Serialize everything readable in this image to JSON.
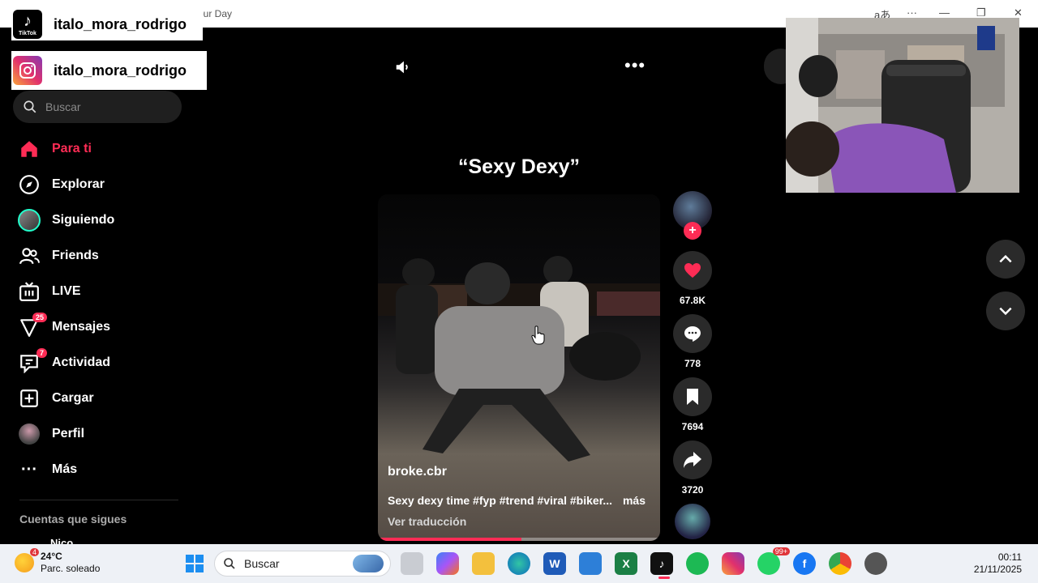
{
  "window": {
    "title_fragment": "our Day",
    "lang_glyph": "aあ",
    "more": "···",
    "minimize": "—",
    "restore": "❐",
    "close": "✕"
  },
  "overlays": {
    "tiktok_badge": {
      "username": "italo_mora_rodrigo",
      "logo_caption": "TikTok"
    },
    "instagram_badge": {
      "username": "italo_mora_rodrigo"
    }
  },
  "sidebar": {
    "search_placeholder": "Buscar",
    "items": [
      {
        "label": "Para ti",
        "icon": "home-icon",
        "active": true
      },
      {
        "label": "Explorar",
        "icon": "compass-icon"
      },
      {
        "label": "Siguiendo",
        "icon": "avatar"
      },
      {
        "label": "Friends",
        "icon": "friends-icon"
      },
      {
        "label": "LIVE",
        "icon": "live-icon"
      },
      {
        "label": "Mensajes",
        "icon": "messages-icon",
        "badge": "25"
      },
      {
        "label": "Actividad",
        "icon": "activity-icon",
        "badge": "7"
      },
      {
        "label": "Cargar",
        "icon": "upload-icon"
      },
      {
        "label": "Perfil",
        "icon": "profile-avatar"
      },
      {
        "label": "Más",
        "icon": "more-icon"
      }
    ],
    "following_title": "Cuentas que sigues",
    "following_first": "Nico"
  },
  "video": {
    "caption": "“Sexy Dexy”",
    "author": "broke.cbr",
    "description": "Sexy dexy time #fyp #trend #viral #biker...",
    "more_label": "más",
    "translate_label": "Ver traducción",
    "progress": 0.51
  },
  "actions": {
    "likes": "67.8K",
    "comments": "778",
    "saves": "7694",
    "shares": "3720"
  },
  "taskbar": {
    "weather_temp": "24°C",
    "weather_cond": "Parc. soleado",
    "weather_badge": "4",
    "search_label": "Buscar",
    "whatsapp_badge": "99+",
    "time": "00:11",
    "date": "21/11/2025"
  },
  "colors": {
    "accent": "#fe2c55",
    "background": "#000000",
    "taskbar": "#eef1f6"
  }
}
